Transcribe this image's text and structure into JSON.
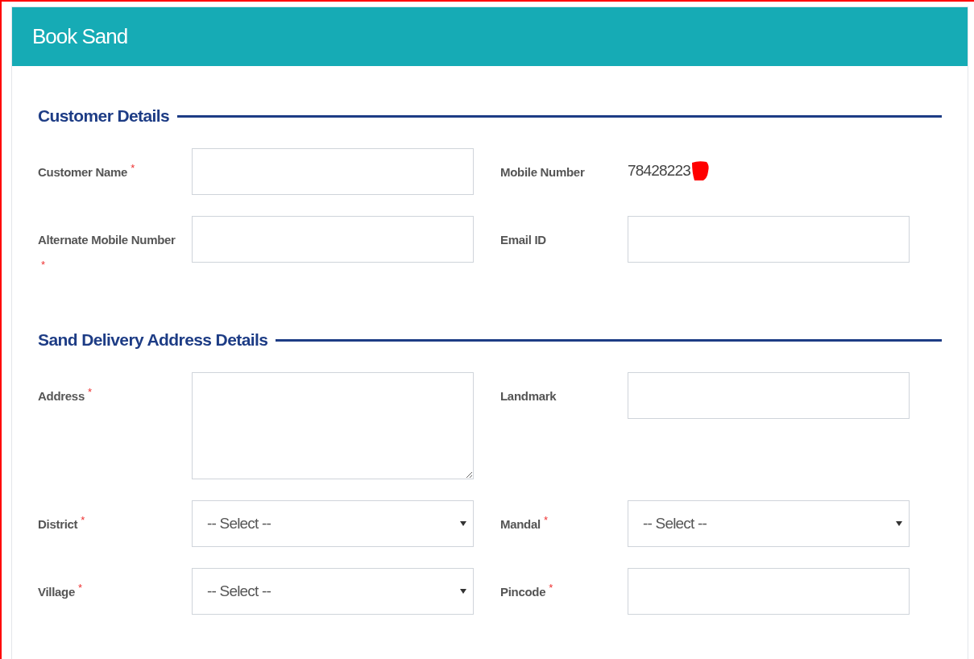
{
  "header": {
    "title": "Book Sand"
  },
  "sections": [
    {
      "title": "Customer Details",
      "fields": [
        {
          "label": "Customer Name",
          "required_mark": "*",
          "kind": "text"
        },
        {
          "label": "Mobile Number",
          "kind": "static",
          "value": "78428223",
          "redacted": true
        },
        {
          "label": "Alternate Mobile Number",
          "required_mark": "*",
          "kind": "text"
        },
        {
          "label": "Email ID",
          "kind": "text"
        }
      ]
    },
    {
      "title": "Sand Delivery Address Details",
      "fields": [
        {
          "label": "Address",
          "required_mark": "*",
          "kind": "textarea"
        },
        {
          "label": "Landmark",
          "kind": "text"
        },
        {
          "label": "District",
          "required_mark": "*",
          "kind": "select",
          "value": "-- Select --"
        },
        {
          "label": "Mandal",
          "required_mark": "*",
          "kind": "select",
          "value": "-- Select --"
        },
        {
          "label": "Village",
          "required_mark": "*",
          "kind": "select",
          "value": "-- Select --"
        },
        {
          "label": "Pincode",
          "required_mark": "*",
          "kind": "text"
        }
      ]
    }
  ]
}
